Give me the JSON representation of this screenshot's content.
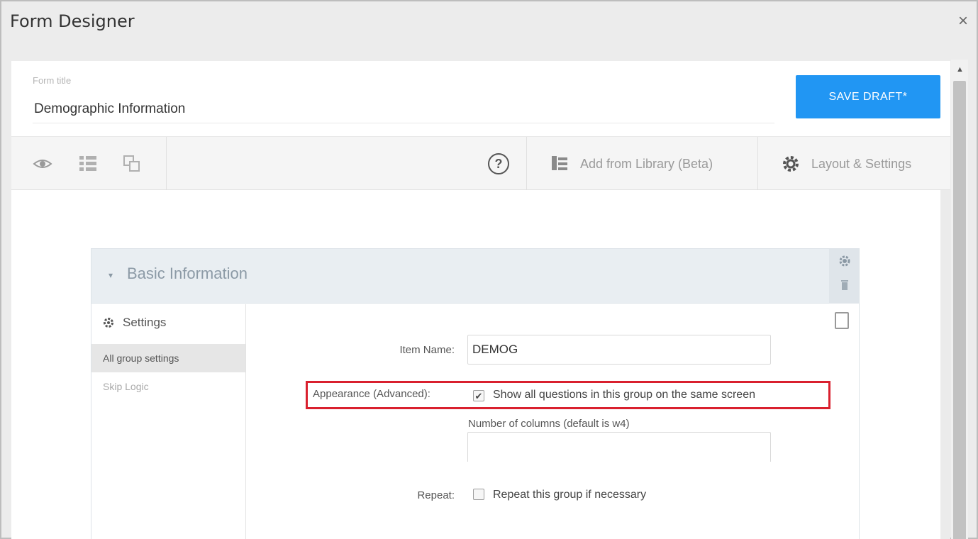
{
  "window": {
    "title": "Form Designer",
    "close_glyph": "×"
  },
  "form": {
    "title_label": "Form title",
    "title_value": "Demographic Information",
    "save_label": "SAVE DRAFT*"
  },
  "toolbar": {
    "icons": [
      "eye-icon",
      "list-icon",
      "copy-icon"
    ],
    "help_glyph": "?",
    "add_library_label": "Add from Library (Beta)",
    "layout_settings_label": "Layout & Settings"
  },
  "group": {
    "title": "Basic Information",
    "caret": "▾",
    "side": {
      "settings_label": "Settings",
      "items": [
        {
          "label": "All group settings",
          "active": true
        },
        {
          "label": "Skip Logic",
          "active": false
        }
      ]
    },
    "item_name_label": "Item Name:",
    "item_name_value": "DEMOG",
    "appearance_label": "Appearance (Advanced):",
    "appearance_checkbox_label": "Show all questions in this group on the same screen",
    "appearance_checked": true,
    "columns_hint": "Number of columns (default is w4)",
    "columns_value": "",
    "repeat_label": "Repeat:",
    "repeat_checkbox_label": "Repeat this group if necessary",
    "repeat_checked": false,
    "check_glyph": "✔"
  },
  "colors": {
    "accent": "#2196f3",
    "highlight": "#d9202e",
    "group_header": "#e9eef2",
    "group_title": "#8c9aa6"
  }
}
